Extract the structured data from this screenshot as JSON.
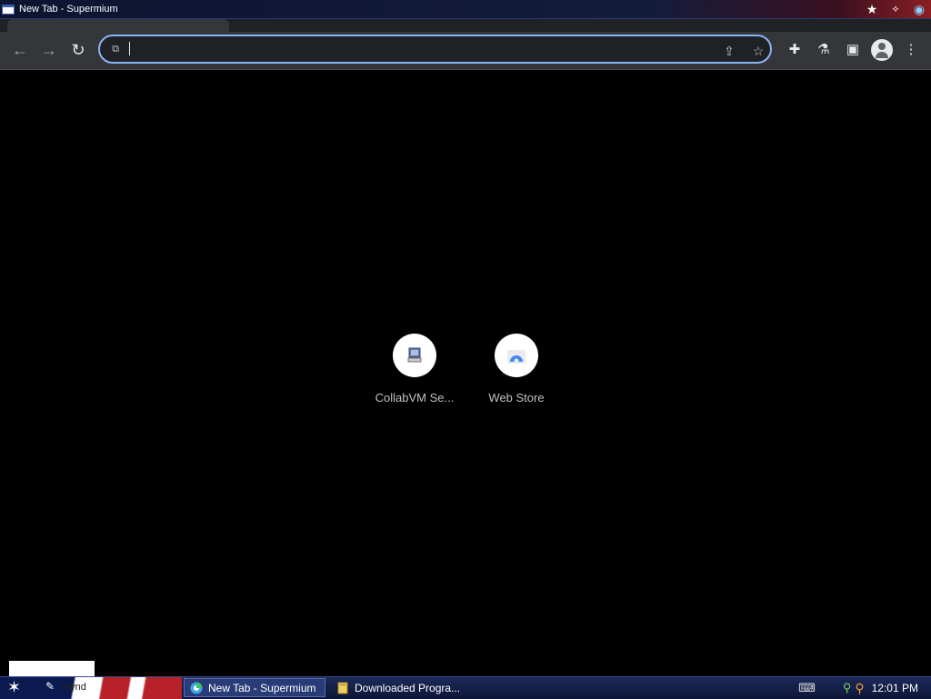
{
  "window": {
    "title": "New Tab - Supermium"
  },
  "toolbar": {
    "back_icon": "arrow-left-icon",
    "forward_icon": "arrow-right-icon",
    "reload_icon": "reload-icon",
    "omnibox_value": "",
    "omnibox_site_icon": "puzzle-site-icon",
    "share_icon": "share-icon",
    "bookmark_icon": "star-icon",
    "extensions_icon": "puzzle-icon",
    "labs_icon": "flask-icon",
    "sidepanel_icon": "side-panel-icon",
    "profile_icon": "avatar-icon",
    "menu_icon": "kebab-menu-icon",
    "accent": "#8ab4f8"
  },
  "shortcuts": [
    {
      "label": "CollabVM Se...",
      "icon": "computer-icon"
    },
    {
      "label": "Web Store",
      "icon": "web-store-icon"
    }
  ],
  "taskbar": {
    "quicklaunch_text": "Mynd",
    "tasks": [
      {
        "label": "New Tab - Supermium",
        "icon": "browser-icon",
        "active": true
      },
      {
        "label": "Downloaded Progra...",
        "icon": "folder-icon",
        "active": false
      }
    ],
    "clock": "12:01 PM"
  }
}
